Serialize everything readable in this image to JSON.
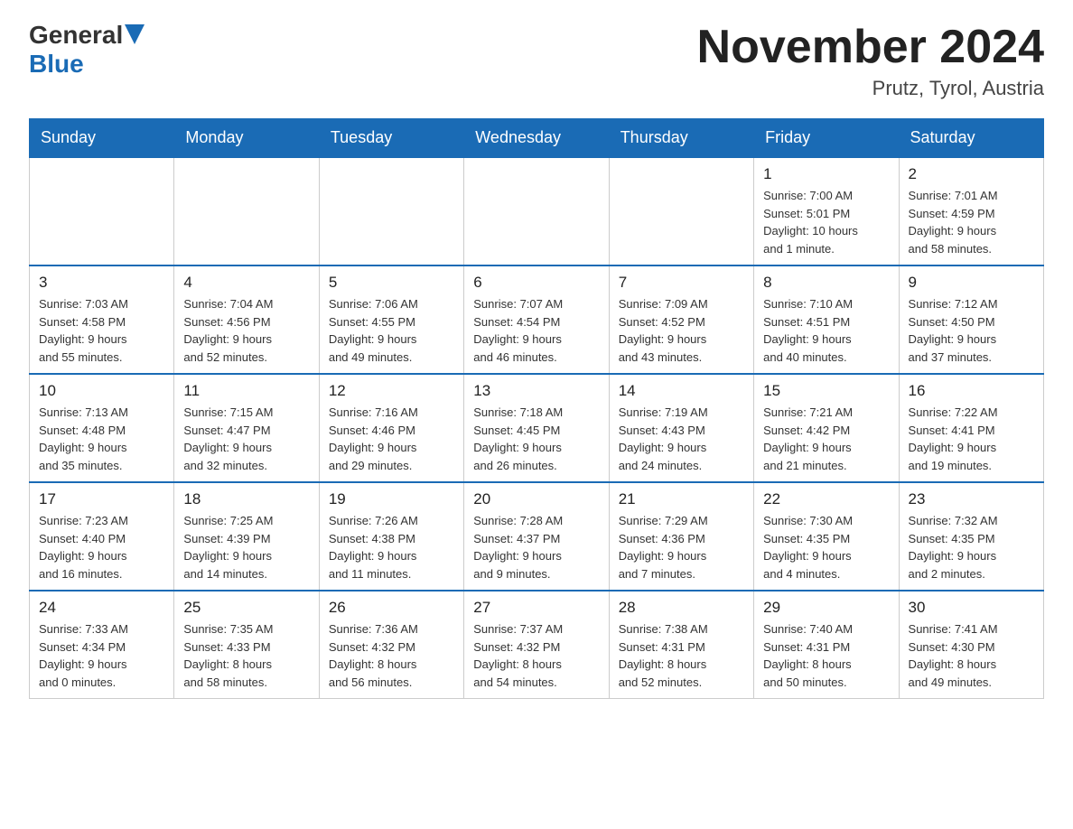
{
  "header": {
    "logo_general": "General",
    "logo_blue": "Blue",
    "title": "November 2024",
    "location": "Prutz, Tyrol, Austria"
  },
  "weekdays": [
    "Sunday",
    "Monday",
    "Tuesday",
    "Wednesday",
    "Thursday",
    "Friday",
    "Saturday"
  ],
  "weeks": [
    [
      {
        "day": "",
        "info": ""
      },
      {
        "day": "",
        "info": ""
      },
      {
        "day": "",
        "info": ""
      },
      {
        "day": "",
        "info": ""
      },
      {
        "day": "",
        "info": ""
      },
      {
        "day": "1",
        "info": "Sunrise: 7:00 AM\nSunset: 5:01 PM\nDaylight: 10 hours\nand 1 minute."
      },
      {
        "day": "2",
        "info": "Sunrise: 7:01 AM\nSunset: 4:59 PM\nDaylight: 9 hours\nand 58 minutes."
      }
    ],
    [
      {
        "day": "3",
        "info": "Sunrise: 7:03 AM\nSunset: 4:58 PM\nDaylight: 9 hours\nand 55 minutes."
      },
      {
        "day": "4",
        "info": "Sunrise: 7:04 AM\nSunset: 4:56 PM\nDaylight: 9 hours\nand 52 minutes."
      },
      {
        "day": "5",
        "info": "Sunrise: 7:06 AM\nSunset: 4:55 PM\nDaylight: 9 hours\nand 49 minutes."
      },
      {
        "day": "6",
        "info": "Sunrise: 7:07 AM\nSunset: 4:54 PM\nDaylight: 9 hours\nand 46 minutes."
      },
      {
        "day": "7",
        "info": "Sunrise: 7:09 AM\nSunset: 4:52 PM\nDaylight: 9 hours\nand 43 minutes."
      },
      {
        "day": "8",
        "info": "Sunrise: 7:10 AM\nSunset: 4:51 PM\nDaylight: 9 hours\nand 40 minutes."
      },
      {
        "day": "9",
        "info": "Sunrise: 7:12 AM\nSunset: 4:50 PM\nDaylight: 9 hours\nand 37 minutes."
      }
    ],
    [
      {
        "day": "10",
        "info": "Sunrise: 7:13 AM\nSunset: 4:48 PM\nDaylight: 9 hours\nand 35 minutes."
      },
      {
        "day": "11",
        "info": "Sunrise: 7:15 AM\nSunset: 4:47 PM\nDaylight: 9 hours\nand 32 minutes."
      },
      {
        "day": "12",
        "info": "Sunrise: 7:16 AM\nSunset: 4:46 PM\nDaylight: 9 hours\nand 29 minutes."
      },
      {
        "day": "13",
        "info": "Sunrise: 7:18 AM\nSunset: 4:45 PM\nDaylight: 9 hours\nand 26 minutes."
      },
      {
        "day": "14",
        "info": "Sunrise: 7:19 AM\nSunset: 4:43 PM\nDaylight: 9 hours\nand 24 minutes."
      },
      {
        "day": "15",
        "info": "Sunrise: 7:21 AM\nSunset: 4:42 PM\nDaylight: 9 hours\nand 21 minutes."
      },
      {
        "day": "16",
        "info": "Sunrise: 7:22 AM\nSunset: 4:41 PM\nDaylight: 9 hours\nand 19 minutes."
      }
    ],
    [
      {
        "day": "17",
        "info": "Sunrise: 7:23 AM\nSunset: 4:40 PM\nDaylight: 9 hours\nand 16 minutes."
      },
      {
        "day": "18",
        "info": "Sunrise: 7:25 AM\nSunset: 4:39 PM\nDaylight: 9 hours\nand 14 minutes."
      },
      {
        "day": "19",
        "info": "Sunrise: 7:26 AM\nSunset: 4:38 PM\nDaylight: 9 hours\nand 11 minutes."
      },
      {
        "day": "20",
        "info": "Sunrise: 7:28 AM\nSunset: 4:37 PM\nDaylight: 9 hours\nand 9 minutes."
      },
      {
        "day": "21",
        "info": "Sunrise: 7:29 AM\nSunset: 4:36 PM\nDaylight: 9 hours\nand 7 minutes."
      },
      {
        "day": "22",
        "info": "Sunrise: 7:30 AM\nSunset: 4:35 PM\nDaylight: 9 hours\nand 4 minutes."
      },
      {
        "day": "23",
        "info": "Sunrise: 7:32 AM\nSunset: 4:35 PM\nDaylight: 9 hours\nand 2 minutes."
      }
    ],
    [
      {
        "day": "24",
        "info": "Sunrise: 7:33 AM\nSunset: 4:34 PM\nDaylight: 9 hours\nand 0 minutes."
      },
      {
        "day": "25",
        "info": "Sunrise: 7:35 AM\nSunset: 4:33 PM\nDaylight: 8 hours\nand 58 minutes."
      },
      {
        "day": "26",
        "info": "Sunrise: 7:36 AM\nSunset: 4:32 PM\nDaylight: 8 hours\nand 56 minutes."
      },
      {
        "day": "27",
        "info": "Sunrise: 7:37 AM\nSunset: 4:32 PM\nDaylight: 8 hours\nand 54 minutes."
      },
      {
        "day": "28",
        "info": "Sunrise: 7:38 AM\nSunset: 4:31 PM\nDaylight: 8 hours\nand 52 minutes."
      },
      {
        "day": "29",
        "info": "Sunrise: 7:40 AM\nSunset: 4:31 PM\nDaylight: 8 hours\nand 50 minutes."
      },
      {
        "day": "30",
        "info": "Sunrise: 7:41 AM\nSunset: 4:30 PM\nDaylight: 8 hours\nand 49 minutes."
      }
    ]
  ]
}
